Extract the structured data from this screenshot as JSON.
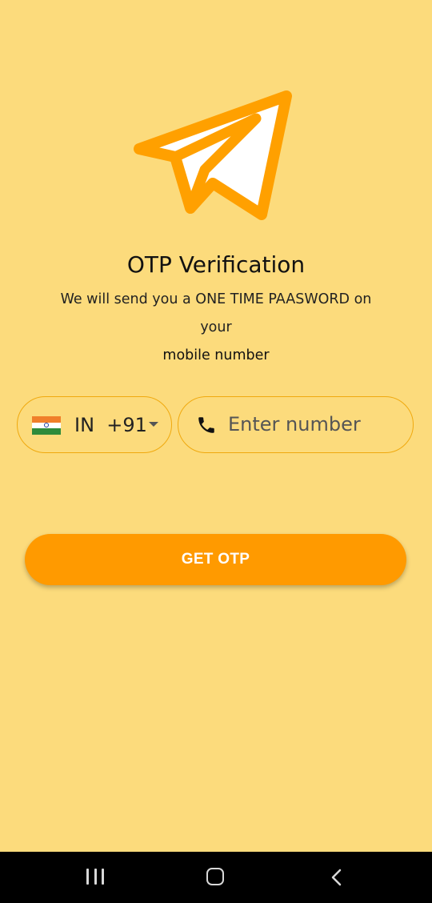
{
  "header": {
    "title": "OTP Verification",
    "subtitle_line1": "We will send you a ONE TIME PAASWORD on your",
    "subtitle_line2": "mobile number"
  },
  "logo": {
    "icon": "paper-plane-icon",
    "stroke_color": "#FFA000",
    "fill_color": "#FFFFFF"
  },
  "country_picker": {
    "flag_icon": "india-flag-icon",
    "selected_value": "IN  +91",
    "dropdown_icon": "caret-down-icon"
  },
  "phone_field": {
    "icon": "phone-icon",
    "value": "",
    "placeholder": "Enter number"
  },
  "actions": {
    "get_otp_label": "GET OTP"
  },
  "theme": {
    "background": "#FCDB7C",
    "accent": "#FF9A00",
    "border": "#F0A90E"
  },
  "nav_bar": {
    "recents_icon": "recents-icon",
    "home_icon": "home-icon",
    "back_icon": "back-icon"
  }
}
